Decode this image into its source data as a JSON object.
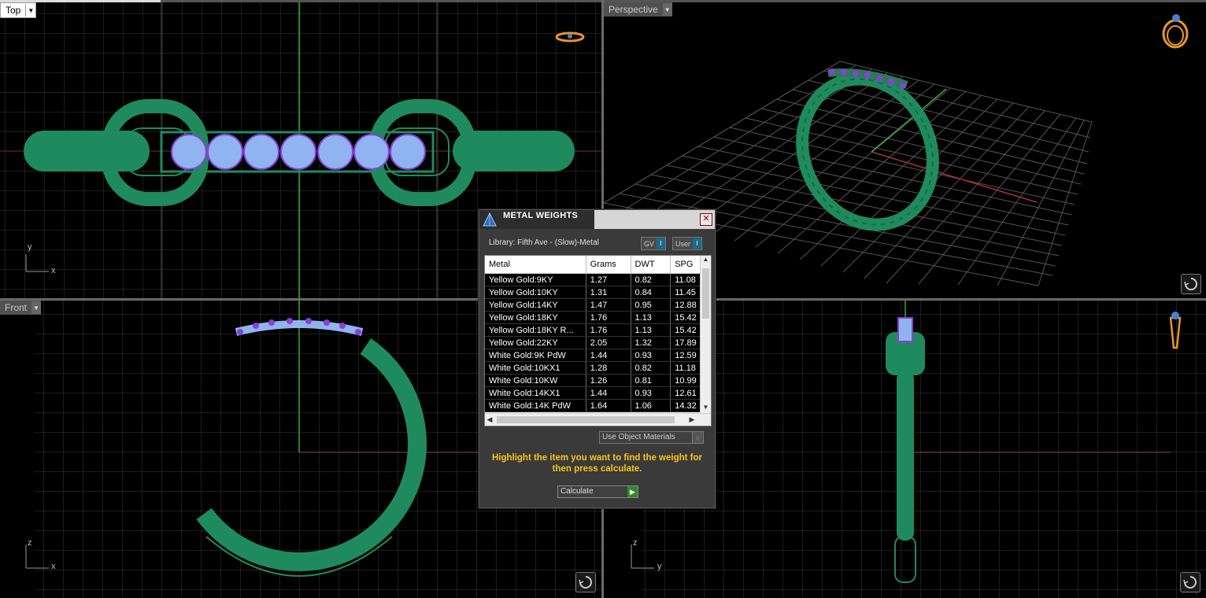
{
  "viewports": {
    "top": {
      "label": "Top",
      "axis_y": "y",
      "axis_x": "x"
    },
    "perspective": {
      "label": "Perspective"
    },
    "front": {
      "label": "Front",
      "axis_y": "z",
      "axis_x": "x"
    },
    "right": {
      "axis_y": "z",
      "axis_x": "y"
    }
  },
  "dialog": {
    "title": "METAL WEIGHTS",
    "close_glyph": "✕",
    "library": "Library: Fifth Ave - (Slow)-Metal",
    "toggle_gv": "GV",
    "toggle_user": "User",
    "toggle_knob": "I",
    "columns": [
      "Metal",
      "Grams",
      "DWT",
      "SPG"
    ],
    "rows": [
      [
        "Yellow Gold:9KY",
        "1.27",
        "0.82",
        "11.08"
      ],
      [
        "Yellow Gold:10KY",
        "1.31",
        "0.84",
        "11.45"
      ],
      [
        "Yellow Gold:14KY",
        "1.47",
        "0.95",
        "12.88"
      ],
      [
        "Yellow Gold:18KY",
        "1.76",
        "1.13",
        "15.42"
      ],
      [
        "Yellow Gold:18KY R...",
        "1.76",
        "1.13",
        "15.42"
      ],
      [
        "Yellow Gold:22KY",
        "2.05",
        "1.32",
        "17.89"
      ],
      [
        "White Gold:9K PdW",
        "1.44",
        "0.93",
        "12.59"
      ],
      [
        "White Gold:10KX1",
        "1.28",
        "0.82",
        "11.18"
      ],
      [
        "White Gold:10KW",
        "1.26",
        "0.81",
        "10.99"
      ],
      [
        "White Gold:14KX1",
        "1.44",
        "0.93",
        "12.61"
      ],
      [
        "White Gold:14K PdW",
        "1.64",
        "1.06",
        "14.32"
      ]
    ],
    "use_object_materials": "Use Object Materials",
    "hint": "Highlight the item you want to find the weight for then press calculate.",
    "calculate": "Calculate"
  },
  "colors": {
    "metal_green": "#1f8a5e",
    "gem_blue": "#8fb4f0",
    "prong_purple": "#8a3fd6",
    "grid": "#3a3a3a",
    "axis_green": "#3aa63a",
    "axis_red": "#b33a3a",
    "hint_yellow": "#f5c518"
  },
  "icons": [
    "dropdown-arrow-icon",
    "ring-preview-icon",
    "rotate-reset-icon",
    "gem-logo-icon",
    "close-icon",
    "play-arrow-icon"
  ]
}
